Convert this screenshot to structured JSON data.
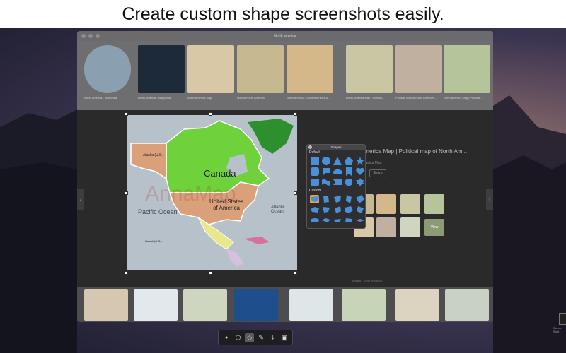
{
  "caption": "Create custom shape screenshots easily.",
  "browser": {
    "title": "North america",
    "top_thumbnails": [
      {
        "caption": "North America - Wikipedia",
        "color": "#8aa0b0"
      },
      {
        "caption": "North America - Wikipedia",
        "color": "#1d2a3a"
      },
      {
        "caption": "North America Map",
        "color": "#d9c8a6"
      },
      {
        "caption": "Map of North America",
        "color": "#c7b98f"
      },
      {
        "caption": "North America Countries Facts &...",
        "color": "#d4b88a"
      },
      {
        "caption": "North America Map | Political...",
        "color": "#c9c6a4"
      },
      {
        "caption": "Political Map of North America ...",
        "color": "#bfb0a0"
      },
      {
        "caption": "North America Map | Political...",
        "color": "#b5c49a"
      }
    ],
    "result_title": "America Map | Political map of North Am...",
    "result_subtitle": "America Map",
    "result_button": "Share",
    "view_button": "View",
    "footer_links": "Images · Send feedback",
    "bottom_thumbnail_colors": [
      "#d6c7b0",
      "#e3e8ec",
      "#cfd6c0",
      "#1f4e8c",
      "#dfe6e8",
      "#c8d4b8",
      "#dcd3c0",
      "#c9d0c4"
    ]
  },
  "map": {
    "labels": {
      "canada": "Canada",
      "usa": "United States\nof America",
      "alaska": "Alaska (U.S.)",
      "pacific": "Pacific Ocean",
      "atlantic": "Atlantic\nOcean",
      "hawaii": "Hawaii (U.S.)",
      "watermark": "AnnaMap"
    },
    "colors": {
      "canada": "#6fd23b",
      "usa": "#d9a07a",
      "alaska": "#d9a07a",
      "mexico": "#e8e88a",
      "greenland": "#2d8f2d",
      "ocean": "#b7c1c9"
    }
  },
  "palette": {
    "title": "Shapes",
    "default_label": "Default",
    "custom_label": "Custom",
    "shape_color": "#4a90d9",
    "default_shapes": [
      "square-shape",
      "circle-shape",
      "triangle-shape",
      "pentagon-shape",
      "star-shape",
      "rounded-square-shape",
      "speech-bubble-shape",
      "cloud-shape",
      "bookmark-shape",
      "heart-shape",
      "blob-shape",
      "wave-shape",
      "flag-shape",
      "badge-shape",
      "gear-shape"
    ],
    "custom_shapes": [
      "usa-map-shape",
      "state-shape-1",
      "state-shape-2",
      "state-shape-3",
      "state-shape-4",
      "country-shape-1",
      "country-shape-2",
      "country-shape-3",
      "country-shape-4",
      "country-shape-5",
      "island-shape-1",
      "island-shape-2",
      "island-shape-3",
      "island-shape-4",
      "island-shape-5"
    ]
  },
  "toolbar": {
    "buttons": [
      "close-icon",
      "shape-icon",
      "shape-select-icon",
      "pen-icon",
      "save-icon",
      "screenshot-icon"
    ]
  },
  "desktop": {
    "dock_label": "Screen Shot"
  }
}
